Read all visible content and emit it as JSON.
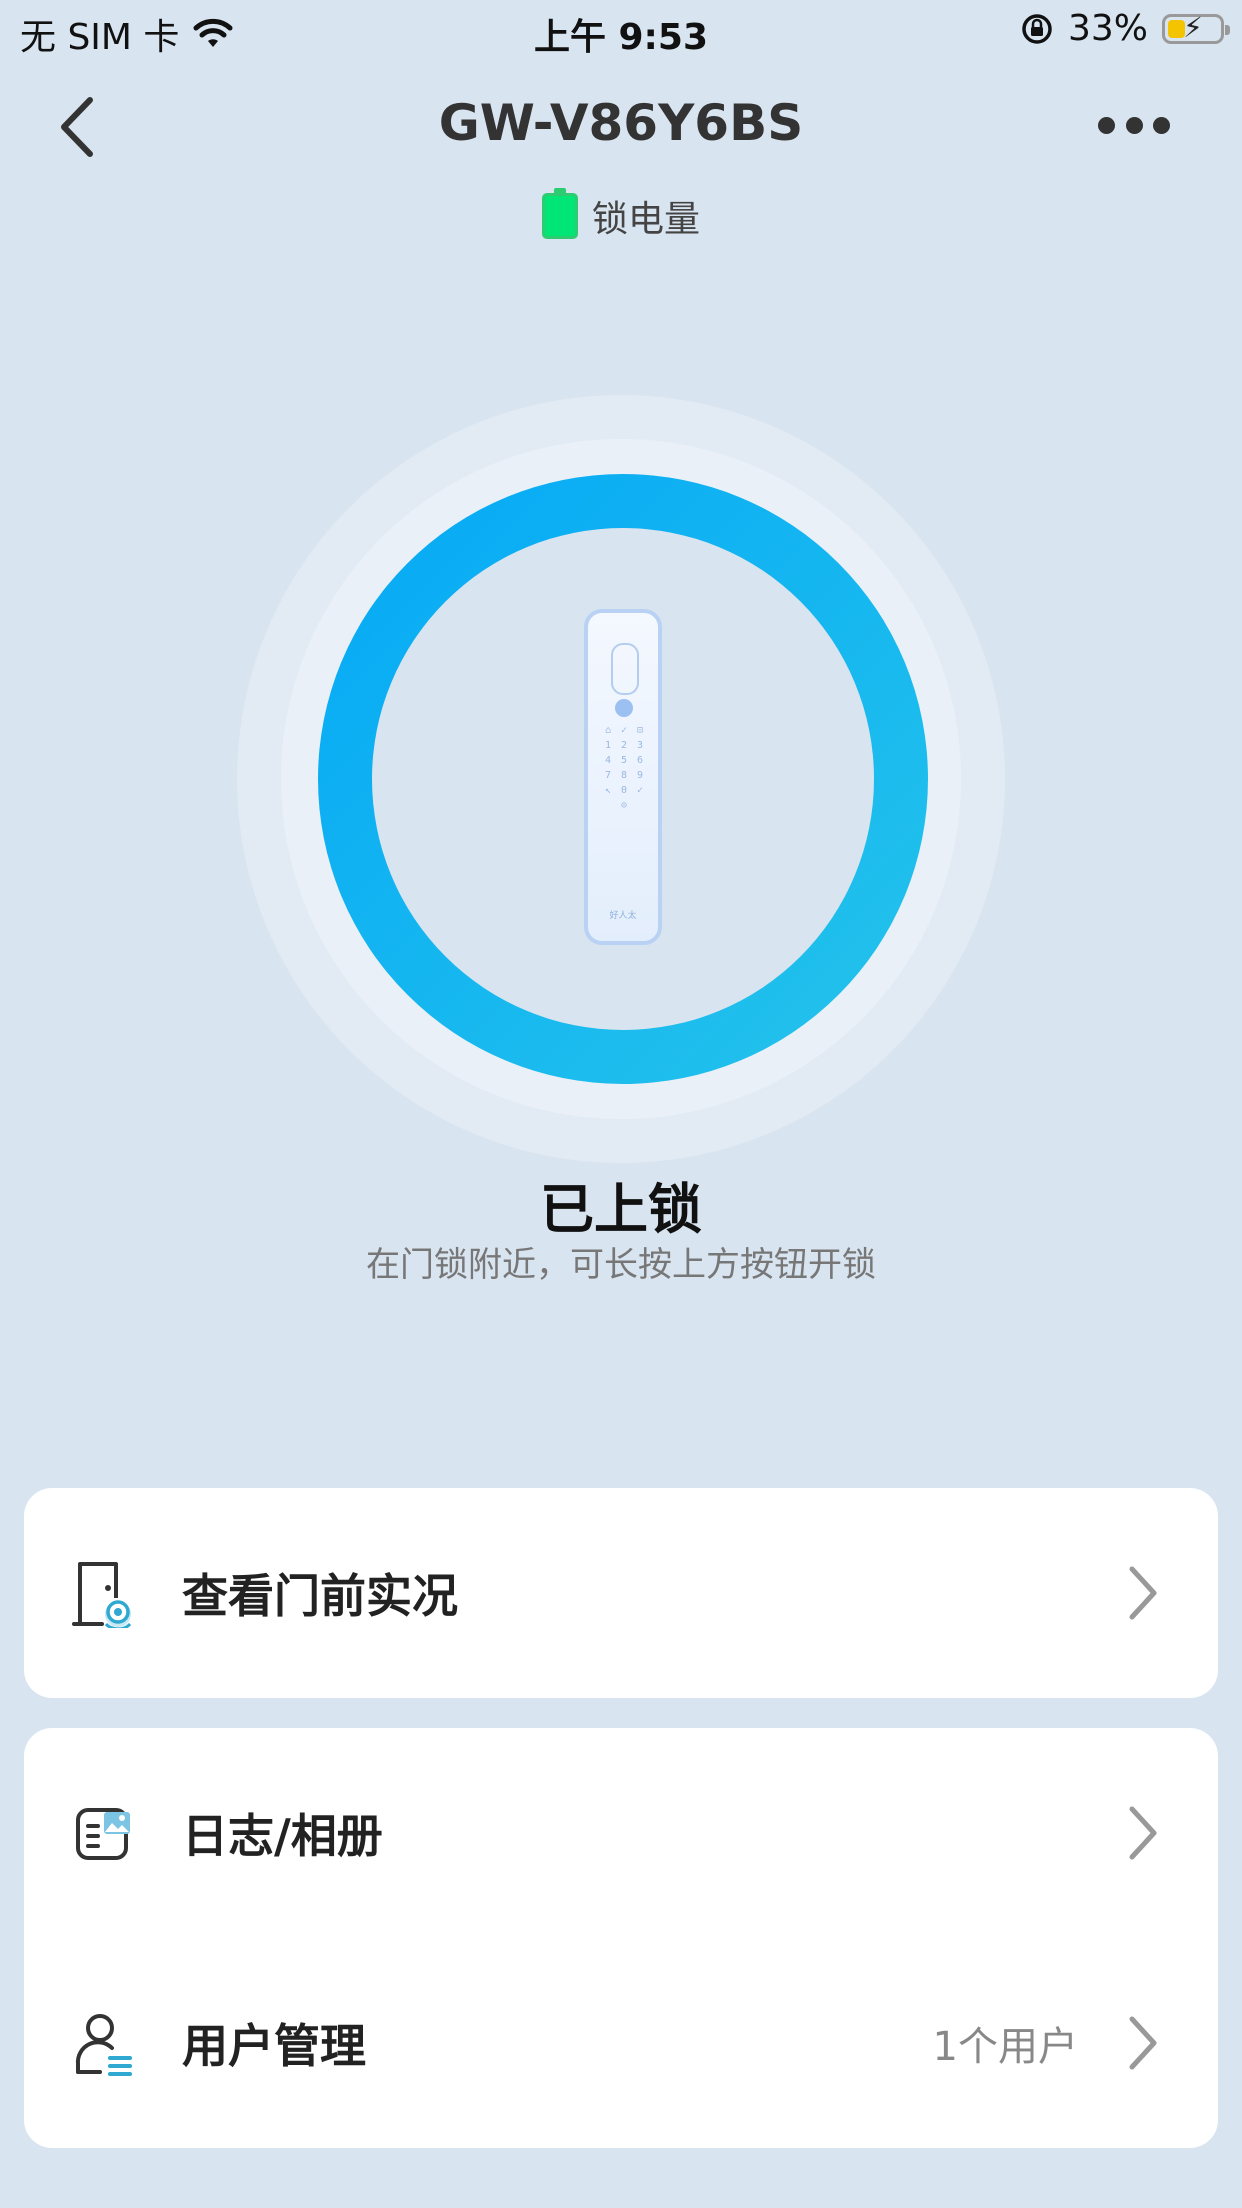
{
  "status_bar": {
    "carrier": "无 SIM 卡",
    "time": "上午 9:53",
    "battery_percent": "33%",
    "battery_level": 0.33,
    "icons": [
      "wifi-icon",
      "rotation-lock-icon",
      "battery-charging-icon"
    ]
  },
  "nav": {
    "title": "GW-V86Y6BS",
    "back_icon": "chevron-left-icon",
    "more_icon": "more-dots-icon"
  },
  "lock_battery": {
    "label": "锁电量",
    "icon": "battery-full-icon",
    "color": "#00e676"
  },
  "lock": {
    "status": "已上锁",
    "hint": "在门锁附近，可长按上方按钮开锁",
    "ring_color_start": "#05a8f6",
    "ring_color_end": "#25c3ea",
    "keypad": [
      "⌂",
      "✓",
      "⊡",
      "1",
      "2",
      "3",
      "4",
      "5",
      "6",
      "7",
      "8",
      "9",
      "↖",
      "0",
      "✓",
      "",
      "⊙",
      ""
    ],
    "brand": "好人太"
  },
  "menu": {
    "live_view": {
      "label": "查看门前实况",
      "icon": "door-camera-icon"
    },
    "logs": {
      "label": "日志/相册",
      "icon": "log-album-icon"
    },
    "users": {
      "label": "用户管理",
      "value": "1个用户",
      "icon": "user-list-icon"
    }
  }
}
